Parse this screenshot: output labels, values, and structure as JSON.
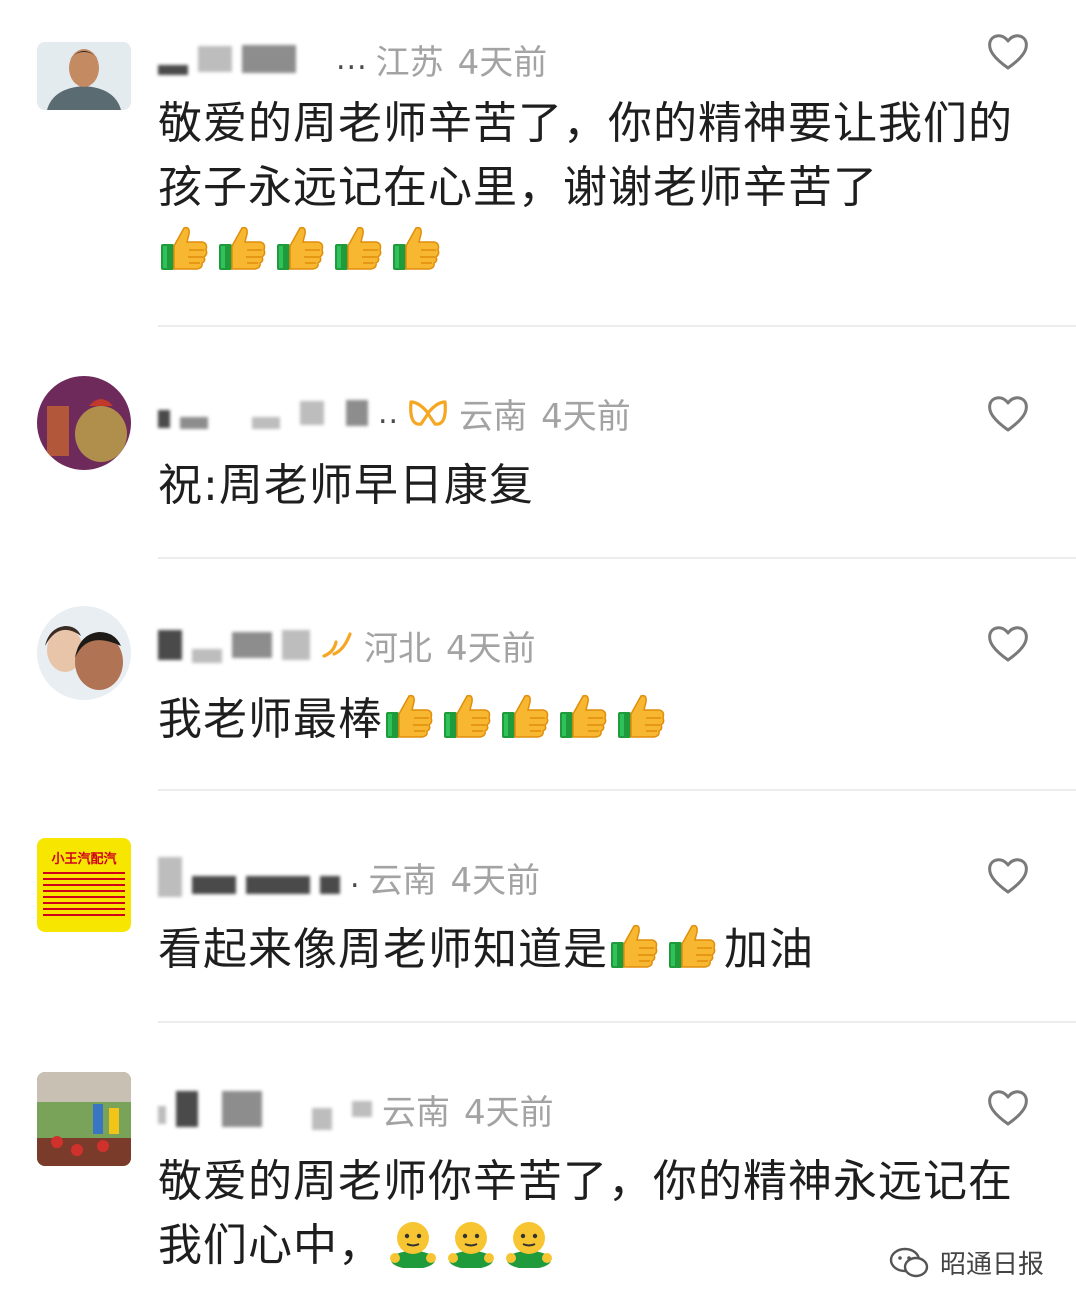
{
  "comments": [
    {
      "location": "江苏",
      "time": "4天前",
      "text": "敬爱的周老师辛苦了，你的精神要让我们的孩子永远记在心里，谢谢老师辛苦了",
      "emojis": [
        "thumbs-up-icon",
        "thumbs-up-icon",
        "thumbs-up-icon",
        "thumbs-up-icon",
        "thumbs-up-icon"
      ]
    },
    {
      "location": "云南",
      "time": "4天前",
      "text": "祝:周老师早日康复",
      "emojis": []
    },
    {
      "location": "河北",
      "time": "4天前",
      "text": "我老师最棒",
      "emojis": [
        "thumbs-up-icon",
        "thumbs-up-icon",
        "thumbs-up-icon",
        "thumbs-up-icon",
        "thumbs-up-icon"
      ]
    },
    {
      "location": "云南",
      "time": "4天前",
      "text_before": "看起来像周老师知道是",
      "text_after": "加油",
      "emojis": [
        "thumbs-up-icon",
        "thumbs-up-icon"
      ],
      "avatar_sign": "小王汽配汽"
    },
    {
      "location": "云南",
      "time": "4天前",
      "text": "敬爱的周老师你辛苦了，你的精神永远记在我们心中，",
      "emojis": [
        "face-icon",
        "face-icon",
        "face-icon"
      ]
    }
  ],
  "watermark": {
    "label": "昭通日报",
    "icon": "wechat-icon"
  },
  "colors": {
    "meta_gray": "#a3a3a3",
    "text": "#1e1e1e",
    "divider": "#ececec",
    "thumb": "#f7b731",
    "cuff": "#1f9b3b"
  }
}
